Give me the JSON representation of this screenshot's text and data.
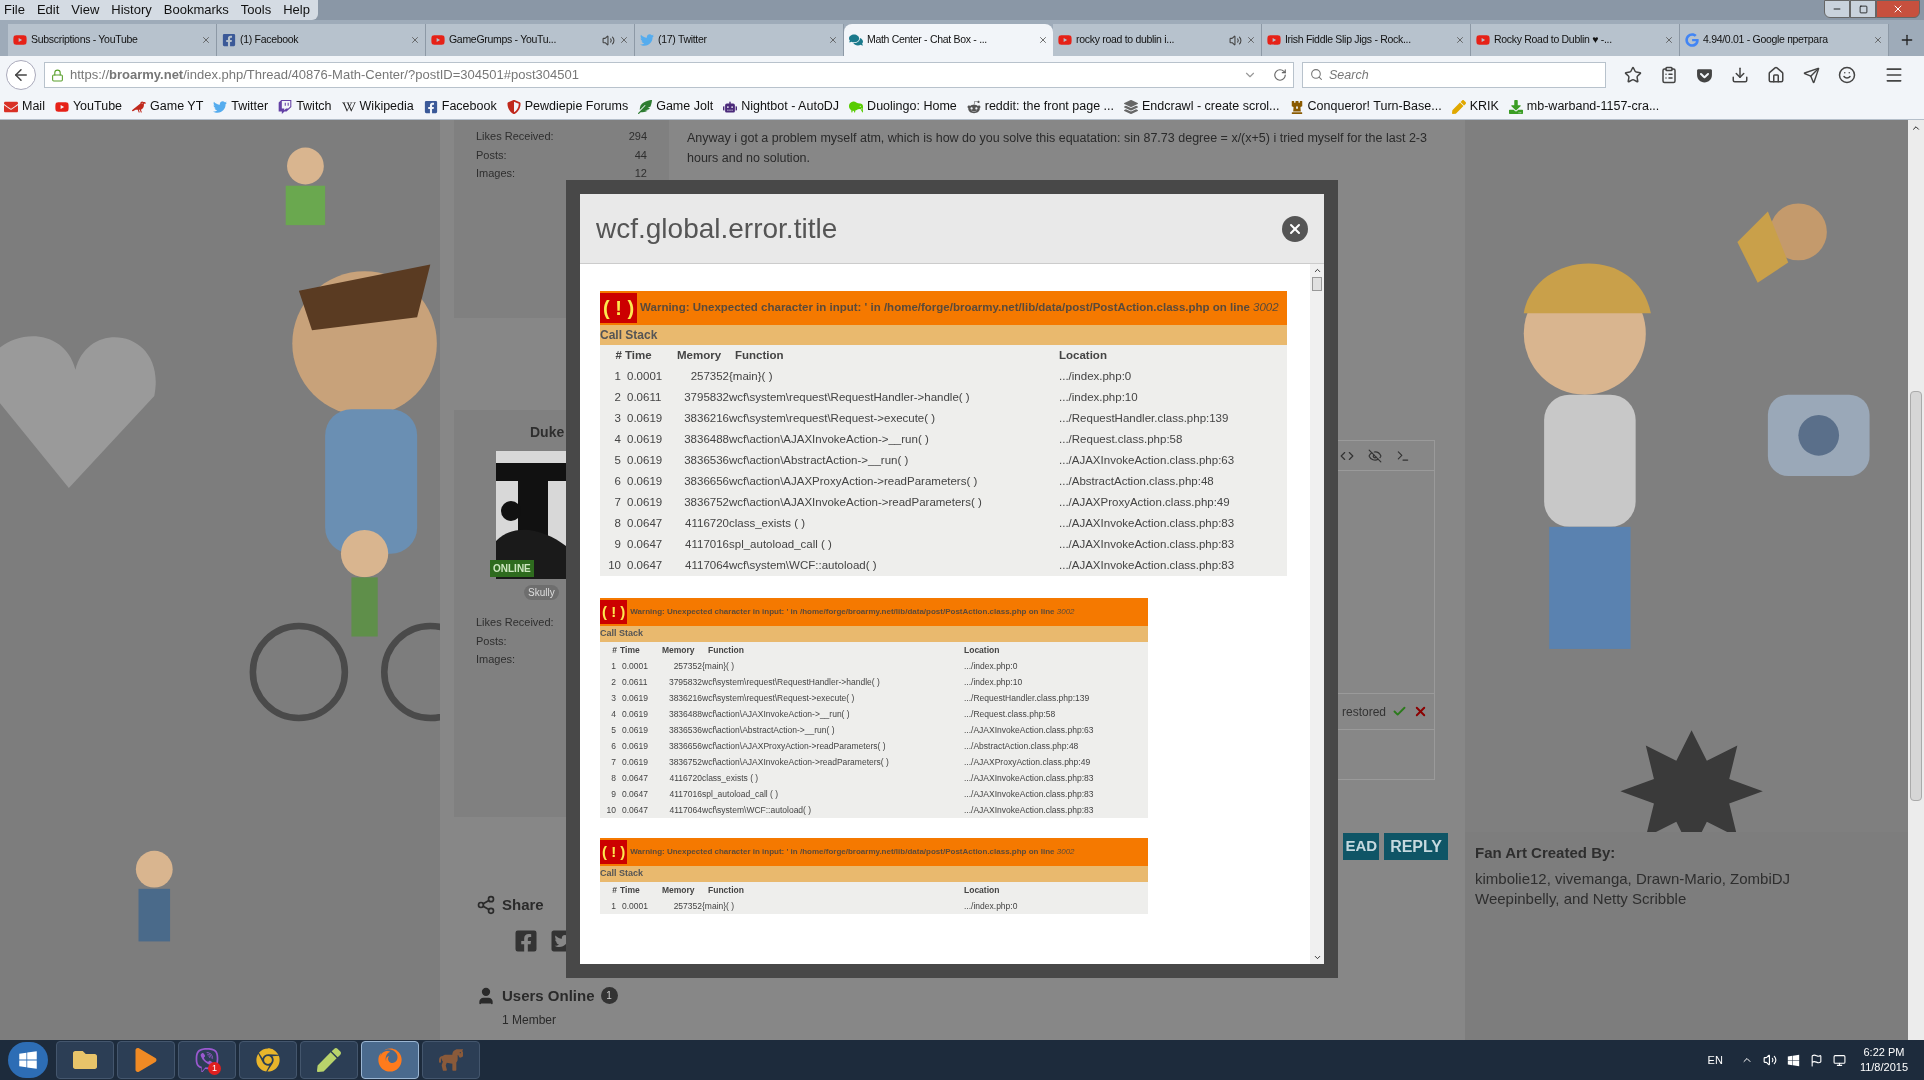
{
  "menu": [
    "File",
    "Edit",
    "View",
    "History",
    "Bookmarks",
    "Tools",
    "Help"
  ],
  "tabs": [
    {
      "label": "Subscriptions - YouTube",
      "audio": false,
      "selected": false
    },
    {
      "label": "(1) Facebook",
      "audio": false,
      "selected": false
    },
    {
      "label": "GameGrumps - YouTu...",
      "audio": true,
      "selected": false
    },
    {
      "label": "(17) Twitter",
      "audio": false,
      "selected": false
    },
    {
      "label": "Math Center - Chat Box - ...",
      "audio": false,
      "selected": true
    },
    {
      "label": "rocky road to dublin i...",
      "audio": true,
      "selected": false
    },
    {
      "label": "Irish Fiddle Slip Jigs - Rock...",
      "audio": false,
      "selected": false
    },
    {
      "label": "Rocky Road to Dublin ♥ -...",
      "audio": false,
      "selected": false
    },
    {
      "label": "4.94/0.01 - Google претрага",
      "audio": false,
      "selected": false
    }
  ],
  "url": "https://**broarmy.net**/index.php/Thread/40876-Math-Center/?postID=304501#post304501",
  "search": {
    "placeholder": "Search"
  },
  "bookmarks": [
    "Mail",
    "YouTube",
    "Game YT",
    "Twitter",
    "Twitch",
    "Wikipedia",
    "Facebook",
    "Pewdiepie Forums",
    "Game Jolt",
    "Nightbot - AutoDJ",
    "Duolingo: Home",
    "reddit: the front page ...",
    "Endcrawl - create scrol...",
    "Conqueror! Turn-Base...",
    "KRIK",
    "mb-warband-1157-cra..."
  ],
  "post1": {
    "stats": [
      {
        "label": "Likes Received:",
        "value": "294"
      },
      {
        "label": "Posts:",
        "value": "44"
      },
      {
        "label": "Images:",
        "value": "12"
      }
    ],
    "text": "Anyway i got a problem myself atm, which is how do you solve this equatation: sin 87.73 degree = x/(x+5) i tried myself for the last 2-3 hours and no solution."
  },
  "post2": {
    "author": "Duke",
    "status": "ONLINE",
    "rank": "Skully",
    "stats": [
      "Likes Received:",
      "Posts:",
      "Images:"
    ],
    "notice": "restored"
  },
  "buttons": [
    "EAD",
    "REPLY"
  ],
  "share": {
    "title": "Share"
  },
  "users_online": {
    "title": "Users Online",
    "count": "1",
    "members": "1 Member"
  },
  "fan_art": {
    "title": "Fan Art Created By:",
    "text": "kimbolie12, vivemanga, Drawn-Mario, ZombiDJ Weepinbelly, and Netty Scribble"
  },
  "dialog": {
    "title": "wcf.global.error.title",
    "errors": [
      {
        "kind": "full",
        "badge": "( ! )",
        "message": "Warning: Unexpected character in input: ' in /home/forge/broarmy.net/lib/data/post/PostAction.class.php on line",
        "line": "3002",
        "heading": "Call Stack",
        "columns": [
          "#",
          "Time",
          "Memory",
          "Function",
          "Location"
        ],
        "rows": [
          {
            "n": "1",
            "time": "0.0001",
            "memory": "257352",
            "function": "{main}( )",
            "location": ".../index.php:0"
          },
          {
            "n": "2",
            "time": "0.0611",
            "memory": "3795832",
            "function": "wcf\\system\\request\\RequestHandler->handle( )",
            "location": ".../index.php:10"
          },
          {
            "n": "3",
            "time": "0.0619",
            "memory": "3836216",
            "function": "wcf\\system\\request\\Request->execute( )",
            "location": ".../RequestHandler.class.php:139"
          },
          {
            "n": "4",
            "time": "0.0619",
            "memory": "3836488",
            "function": "wcf\\action\\AJAXInvokeAction->__run( )",
            "location": ".../Request.class.php:58"
          },
          {
            "n": "5",
            "time": "0.0619",
            "memory": "3836536",
            "function": "wcf\\action\\AbstractAction->__run( )",
            "location": ".../AJAXInvokeAction.class.php:63"
          },
          {
            "n": "6",
            "time": "0.0619",
            "memory": "3836656",
            "function": "wcf\\action\\AJAXProxyAction->readParameters( )",
            "location": ".../AbstractAction.class.php:48"
          },
          {
            "n": "7",
            "time": "0.0619",
            "memory": "3836752",
            "function": "wcf\\action\\AJAXInvokeAction->readParameters( )",
            "location": ".../AJAXProxyAction.class.php:49"
          },
          {
            "n": "8",
            "time": "0.0647",
            "memory": "4116720",
            "function": "class_exists ( )",
            "location": ".../AJAXInvokeAction.class.php:83"
          },
          {
            "n": "9",
            "time": "0.0647",
            "memory": "4117016",
            "function": "spl_autoload_call ( )",
            "location": ".../AJAXInvokeAction.class.php:83"
          },
          {
            "n": "10",
            "time": "0.0647",
            "memory": "4117064",
            "function": "wcf\\system\\WCF::autoload( )",
            "location": ".../AJAXInvokeAction.class.php:83"
          }
        ]
      },
      {
        "kind": "compact",
        "badge": "( ! )",
        "message": "Warning: Unexpected character in input: ' in /home/forge/broarmy.net/lib/data/post/PostAction.class.php on line",
        "line": "3002",
        "heading": "Call Stack",
        "columns": [
          "#",
          "Time",
          "Memory",
          "Function",
          "Location"
        ],
        "rows": [
          {
            "n": "1",
            "time": "0.0001",
            "memory": "257352",
            "function": "{main}( )",
            "location": ".../index.php:0"
          },
          {
            "n": "2",
            "time": "0.0611",
            "memory": "3795832",
            "function": "wcf\\system\\request\\RequestHandler->handle( )",
            "location": ".../index.php:10"
          },
          {
            "n": "3",
            "time": "0.0619",
            "memory": "3836216",
            "function": "wcf\\system\\request\\Request->execute( )",
            "location": ".../RequestHandler.class.php:139"
          },
          {
            "n": "4",
            "time": "0.0619",
            "memory": "3836488",
            "function": "wcf\\action\\AJAXInvokeAction->__run( )",
            "location": ".../Request.class.php:58"
          },
          {
            "n": "5",
            "time": "0.0619",
            "memory": "3836536",
            "function": "wcf\\action\\AbstractAction->__run( )",
            "location": ".../AJAXInvokeAction.class.php:63"
          },
          {
            "n": "6",
            "time": "0.0619",
            "memory": "3836656",
            "function": "wcf\\action\\AJAXProxyAction->readParameters( )",
            "location": ".../AbstractAction.class.php:48"
          },
          {
            "n": "7",
            "time": "0.0619",
            "memory": "3836752",
            "function": "wcf\\action\\AJAXInvokeAction->readParameters( )",
            "location": ".../AJAXProxyAction.class.php:49"
          },
          {
            "n": "8",
            "time": "0.0647",
            "memory": "4116720",
            "function": "class_exists ( )",
            "location": ".../AJAXInvokeAction.class.php:83"
          },
          {
            "n": "9",
            "time": "0.0647",
            "memory": "4117016",
            "function": "spl_autoload_call ( )",
            "location": ".../AJAXInvokeAction.class.php:83"
          },
          {
            "n": "10",
            "time": "0.0647",
            "memory": "4117064",
            "function": "wcf\\system\\WCF::autoload( )",
            "location": ".../AJAXInvokeAction.class.php:83"
          }
        ]
      },
      {
        "kind": "compact",
        "badge": "( ! )",
        "message": "Warning: Unexpected character in input: ' in /home/forge/broarmy.net/lib/data/post/PostAction.class.php on line",
        "line": "3002",
        "heading": "Call Stack",
        "columns": [
          "#",
          "Time",
          "Memory",
          "Function",
          "Location"
        ],
        "rows": [
          {
            "n": "1",
            "time": "0.0001",
            "memory": "257352",
            "function": "{main}( )",
            "location": ".../index.php:0"
          }
        ]
      }
    ]
  },
  "taskbar": {
    "apps": [
      {
        "selected": false
      },
      {
        "selected": false
      },
      {
        "selected": false,
        "badge": "1"
      },
      {
        "selected": false
      },
      {
        "selected": false
      },
      {
        "selected": true
      },
      {
        "selected": false
      }
    ],
    "language": "EN",
    "time": "6:22 PM",
    "date": "11/8/2015"
  }
}
